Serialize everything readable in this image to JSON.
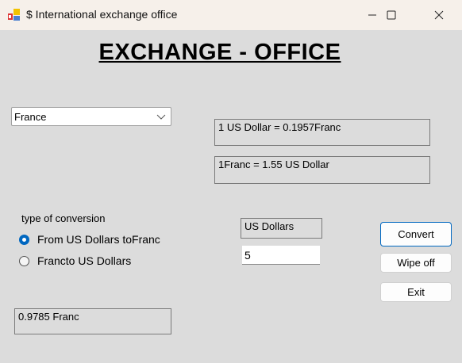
{
  "window": {
    "title": "$ International exchange office",
    "icon": "app-icon",
    "controls": [
      "minimize-icon",
      "maximize-icon",
      "close-icon"
    ]
  },
  "heading": "EXCHANGE - OFFICE",
  "country_combo": {
    "value": "France"
  },
  "rate_usd_to_local": "1 US Dollar = 0.1957Franc",
  "rate_local_to_usd": "1Franc = 1.55 US Dollar",
  "conversion": {
    "label": "type of conversion",
    "options": [
      {
        "label": "From US Dollars toFranc",
        "checked": true
      },
      {
        "label": "Francto US Dollars",
        "checked": false
      }
    ]
  },
  "amount": {
    "unit_label": "US Dollars",
    "value": "5"
  },
  "buttons": {
    "convert": "Convert",
    "wipe": "Wipe off",
    "exit": "Exit"
  },
  "result": "0.9785 Franc",
  "colors": {
    "accent": "#0067c0",
    "background": "#dcdcdc"
  }
}
